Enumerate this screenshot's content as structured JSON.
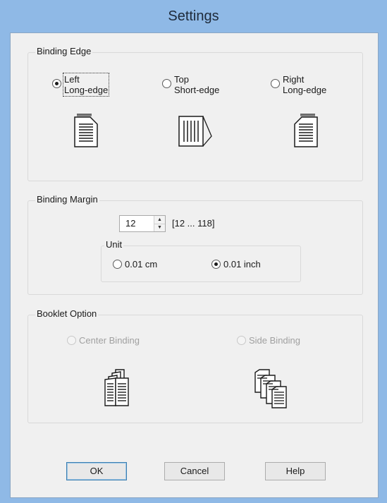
{
  "window": {
    "title": "Settings"
  },
  "binding_edge": {
    "legend": "Binding Edge",
    "options": [
      {
        "line1": "Left",
        "line2": "Long-edge",
        "checked": true
      },
      {
        "line1": "Top",
        "line2": "Short-edge",
        "checked": false
      },
      {
        "line1": "Right",
        "line2": "Long-edge",
        "checked": false
      }
    ]
  },
  "binding_margin": {
    "legend": "Binding Margin",
    "value": "12",
    "range": "[12 ... 118]",
    "unit": {
      "legend": "Unit",
      "options": [
        {
          "label": "0.01 cm",
          "checked": false
        },
        {
          "label": "0.01 inch",
          "checked": true
        }
      ]
    }
  },
  "booklet_option": {
    "legend": "Booklet Option",
    "options": [
      {
        "label": "Center Binding",
        "checked": false,
        "disabled": true
      },
      {
        "label": "Side Binding",
        "checked": false,
        "disabled": true
      }
    ]
  },
  "buttons": {
    "ok": "OK",
    "cancel": "Cancel",
    "help": "Help"
  }
}
